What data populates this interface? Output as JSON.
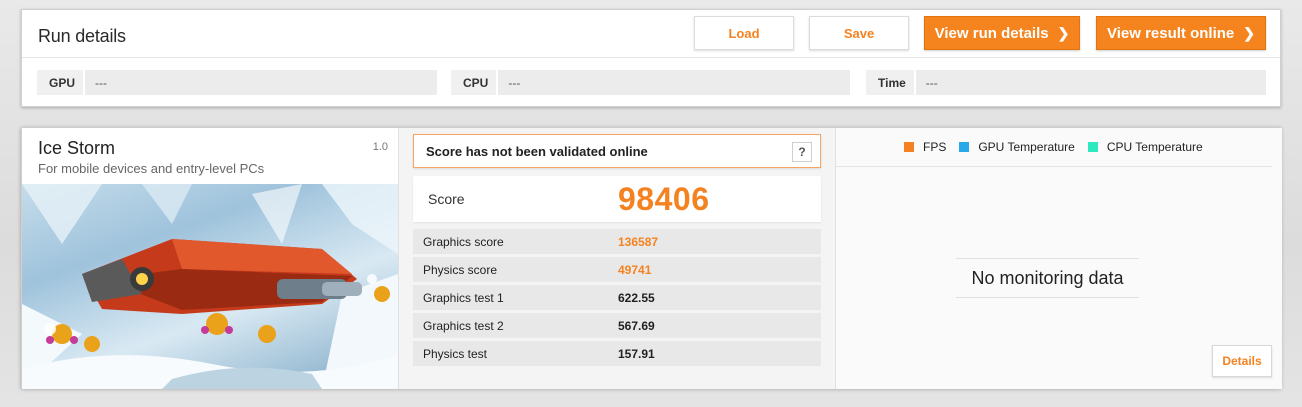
{
  "run_details": {
    "title": "Run details",
    "buttons": {
      "load": "Load",
      "save": "Save",
      "view_run_details": "View run details",
      "view_result_online": "View result online"
    },
    "fields": [
      {
        "label": "GPU",
        "value": "---"
      },
      {
        "label": "CPU",
        "value": "---"
      },
      {
        "label": "Time",
        "value": "---"
      }
    ]
  },
  "test": {
    "name": "Ice Storm",
    "description": "For mobile devices and entry-level PCs",
    "version": "1.0"
  },
  "score": {
    "validation_message": "Score has not been validated online",
    "help": "?",
    "label": "Score",
    "value": "98406",
    "rows": [
      {
        "label": "Graphics score",
        "value": "136587",
        "highlight": true
      },
      {
        "label": "Physics score",
        "value": "49741",
        "highlight": true
      },
      {
        "label": "Graphics test 1",
        "value": "622.55",
        "highlight": false
      },
      {
        "label": "Graphics test 2",
        "value": "567.69",
        "highlight": false
      },
      {
        "label": "Physics test",
        "value": "157.91",
        "highlight": false
      }
    ]
  },
  "monitoring": {
    "legend": [
      {
        "label": "FPS",
        "color": "#f58220"
      },
      {
        "label": "GPU Temperature",
        "color": "#2aa9e8"
      },
      {
        "label": "CPU Temperature",
        "color": "#2ee8c0"
      }
    ],
    "empty_message": "No monitoring data",
    "details_button": "Details"
  },
  "colors": {
    "accent": "#f58220"
  }
}
